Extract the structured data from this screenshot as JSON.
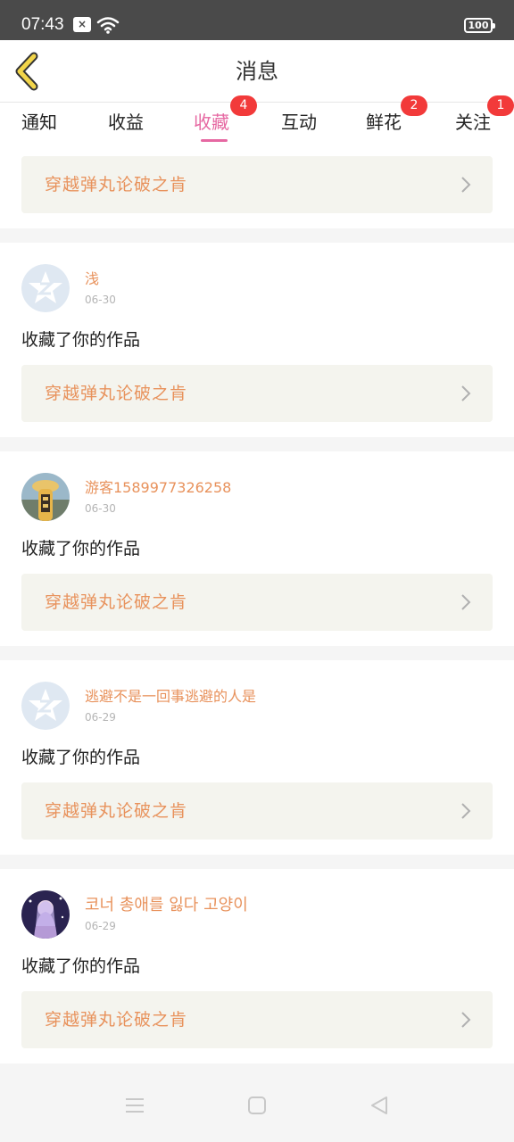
{
  "status_bar": {
    "time": "07:43",
    "notification": "×",
    "battery": "100"
  },
  "header": {
    "title": "消息"
  },
  "tabs": [
    {
      "label": "通知",
      "badge": ""
    },
    {
      "label": "收益",
      "badge": ""
    },
    {
      "label": "收藏",
      "badge": "4",
      "active": true
    },
    {
      "label": "互动",
      "badge": ""
    },
    {
      "label": "鲜花",
      "badge": "2"
    },
    {
      "label": "关注",
      "badge": "1"
    }
  ],
  "top_work": {
    "title": "穿越弹丸论破之肯"
  },
  "messages": [
    {
      "username": "浅",
      "date": "06-30",
      "action": "收藏了你的作品",
      "work_title": "穿越弹丸论破之肯",
      "avatar": "default-avatar"
    },
    {
      "username": "游客1589977326258",
      "date": "06-30",
      "action": "收藏了你的作品",
      "work_title": "穿越弹丸论破之肯",
      "avatar": "photo-avatar"
    },
    {
      "username": "逃避不是一回事逃避的人是",
      "date": "06-29",
      "action": "收藏了你的作品",
      "work_title": "穿越弹丸论破之肯",
      "avatar": "default-avatar"
    },
    {
      "username": "코너 총애를 잃다 고양이",
      "date": "06-29",
      "action": "收藏了你的作品",
      "work_title": "穿越弹丸论破之肯",
      "avatar": "anime-avatar"
    }
  ],
  "colors": {
    "accent": "#e668a2",
    "work_title": "#e8925c",
    "badge": "#f23a3a",
    "card_link_bg": "#f4f4ee"
  }
}
